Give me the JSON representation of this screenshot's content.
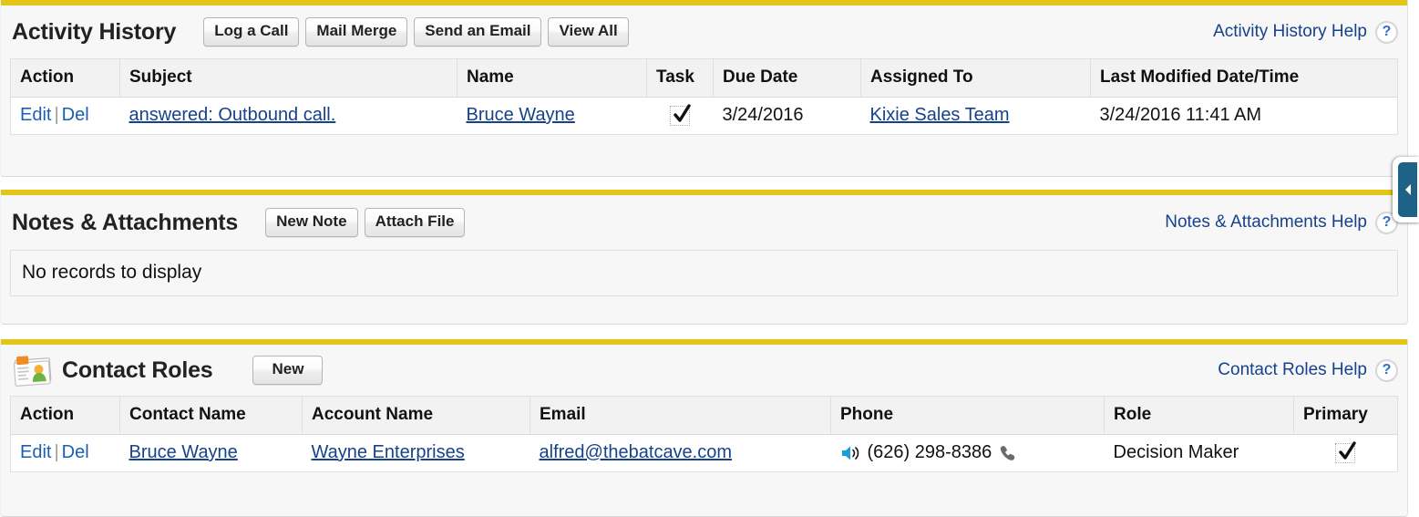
{
  "theme": {
    "accent_bar": "#E3C515",
    "link_color": "#15428B",
    "panel_bg": "#F7F7F7",
    "header_row_bg": "#F2F2F2",
    "sidebar_tab_color": "#1F6287",
    "phone_icon_color": "#189FD8"
  },
  "sections": [
    {
      "id": "activity-history",
      "title": "Activity History",
      "has_icon": false,
      "buttons": [
        "Log a Call",
        "Mail Merge",
        "Send an Email",
        "View All"
      ],
      "help_label": "Activity History Help",
      "help_icon": "question-mark-icon",
      "columns": [
        "Action",
        "Subject",
        "Name",
        "Task",
        "Due Date",
        "Assigned To",
        "Last Modified Date/Time"
      ],
      "rows": [
        {
          "action_edit": "Edit",
          "action_sep": "|",
          "action_del": "Del",
          "subject": "answered: Outbound call.",
          "name": "Bruce Wayne",
          "task": "checked",
          "due_date": "3/24/2016",
          "assigned_to": "Kixie Sales Team",
          "last_modified": "3/24/2016 11:41 AM"
        }
      ]
    },
    {
      "id": "notes-attachments",
      "title": "Notes & Attachments",
      "has_icon": false,
      "buttons": [
        "New Note",
        "Attach File"
      ],
      "help_label": "Notes & Attachments Help",
      "help_icon": "question-mark-icon",
      "empty_message": "No records to display"
    },
    {
      "id": "contact-roles",
      "title": "Contact Roles",
      "has_icon": true,
      "icon_name": "contact-card-icon",
      "buttons": [
        "New"
      ],
      "help_label": "Contact Roles Help",
      "help_icon": "question-mark-icon",
      "columns": [
        "Action",
        "Contact Name",
        "Account Name",
        "Email",
        "Phone",
        "Role",
        "Primary"
      ],
      "rows": [
        {
          "action_edit": "Edit",
          "action_sep": "|",
          "action_del": "Del",
          "contact_name": "Bruce Wayne",
          "account_name": "Wayne Enterprises",
          "email": "alfred@thebatcave.com",
          "phone": "(626) 298-8386",
          "phone_lead_icon": "click-to-call-icon",
          "phone_trail_icon": "telephone-handset-icon",
          "role": "Decision Maker",
          "primary": "checked"
        }
      ]
    }
  ],
  "sidebar_tab": {
    "icon": "chevron-left-icon",
    "label": ""
  }
}
